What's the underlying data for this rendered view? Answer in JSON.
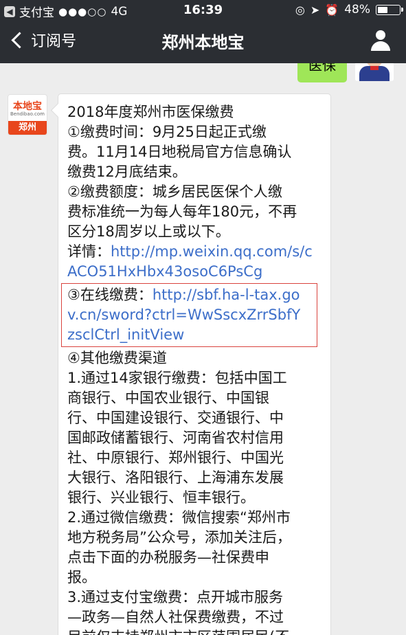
{
  "status_bar": {
    "app_back": "支付宝",
    "signal": "●●●○○",
    "network": "4G",
    "time": "16:39",
    "battery": "48%",
    "battery_level": 0.48
  },
  "nav": {
    "back_label": "订阅号",
    "title": "郑州本地宝"
  },
  "my_message": {
    "text": "医保"
  },
  "sender_avatar": {
    "brand": "本地宝",
    "domain": "Bendibao.com",
    "city": "郑州"
  },
  "message": {
    "lines": [
      "2018年度郑州市医保缴费",
      "①缴费时间：9月25日起正式缴",
      "费。11月14日地税局官方信息确认",
      "缴费12月底结束。",
      "②缴费额度：城乡居民医保个人缴",
      "费标准统一为每人每年180元，不再",
      "区分18周岁以上或以下。"
    ],
    "detail_prefix": "详情：",
    "detail_link_line1": "http://mp.weixin.qq.com/s/c",
    "detail_link_line2": "ACO51HxHbx43osoC6PsCg",
    "online_prefix": "③在线缴费：",
    "online_link_line1": "http://sbf.ha-l-tax.go",
    "online_link_line2": "v.cn/sword?ctrl=WwSscxZrrSbfY",
    "online_link_line3": "zsclCtrl_initView",
    "lines2": [
      "④其他缴费渠道",
      "1.通过14家银行缴费：包括中国工",
      "商银行、中国农业银行、中国银",
      "行、中国建设银行、交通银行、中",
      "国邮政储蓄银行、河南省农村信用",
      "社、中原银行、郑州银行、中国光",
      "大银行、洛阳银行、上海浦东发展",
      "银行、兴业银行、恒丰银行。",
      "2.通过微信缴费：微信搜索“郑州市",
      "地方税务局”公众号，添加关注后，",
      "点击下面的办税服务—社保费申",
      "报。",
      "3.通过支付宝缴费：点开城市服务",
      "—政务—自然人社保费缴费，不过",
      "目前仅支持郑州市市区范围居民(不"
    ]
  }
}
